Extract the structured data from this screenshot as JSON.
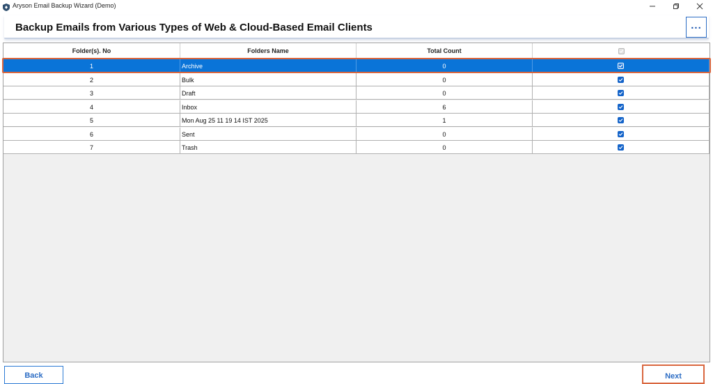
{
  "window": {
    "title": "Aryson Email Backup Wizard (Demo)"
  },
  "header": {
    "title": "Backup Emails from Various Types of Web & Cloud-Based Email Clients",
    "more_label": "..."
  },
  "table": {
    "columns": [
      "Folder(s). No",
      "Folders Name",
      "Total Count",
      ""
    ],
    "header_checkbox_checked": true,
    "rows": [
      {
        "no": "1",
        "name": "Archive",
        "count": "0",
        "checked": true,
        "selected": true
      },
      {
        "no": "2",
        "name": "Bulk",
        "count": "0",
        "checked": true,
        "selected": false
      },
      {
        "no": "3",
        "name": "Draft",
        "count": "0",
        "checked": true,
        "selected": false
      },
      {
        "no": "4",
        "name": "Inbox",
        "count": "6",
        "checked": true,
        "selected": false
      },
      {
        "no": "5",
        "name": "Mon Aug 25 11 19 14 IST 2025",
        "count": "1",
        "checked": true,
        "selected": false
      },
      {
        "no": "6",
        "name": "Sent",
        "count": "0",
        "checked": true,
        "selected": false
      },
      {
        "no": "7",
        "name": "Trash",
        "count": "0",
        "checked": true,
        "selected": false
      }
    ]
  },
  "footer": {
    "back_label": "Back",
    "next_label": "Next"
  },
  "colors": {
    "accent": "#0a74d8",
    "highlight_outline": "#d9663e",
    "checkbox": "#1363c9"
  }
}
